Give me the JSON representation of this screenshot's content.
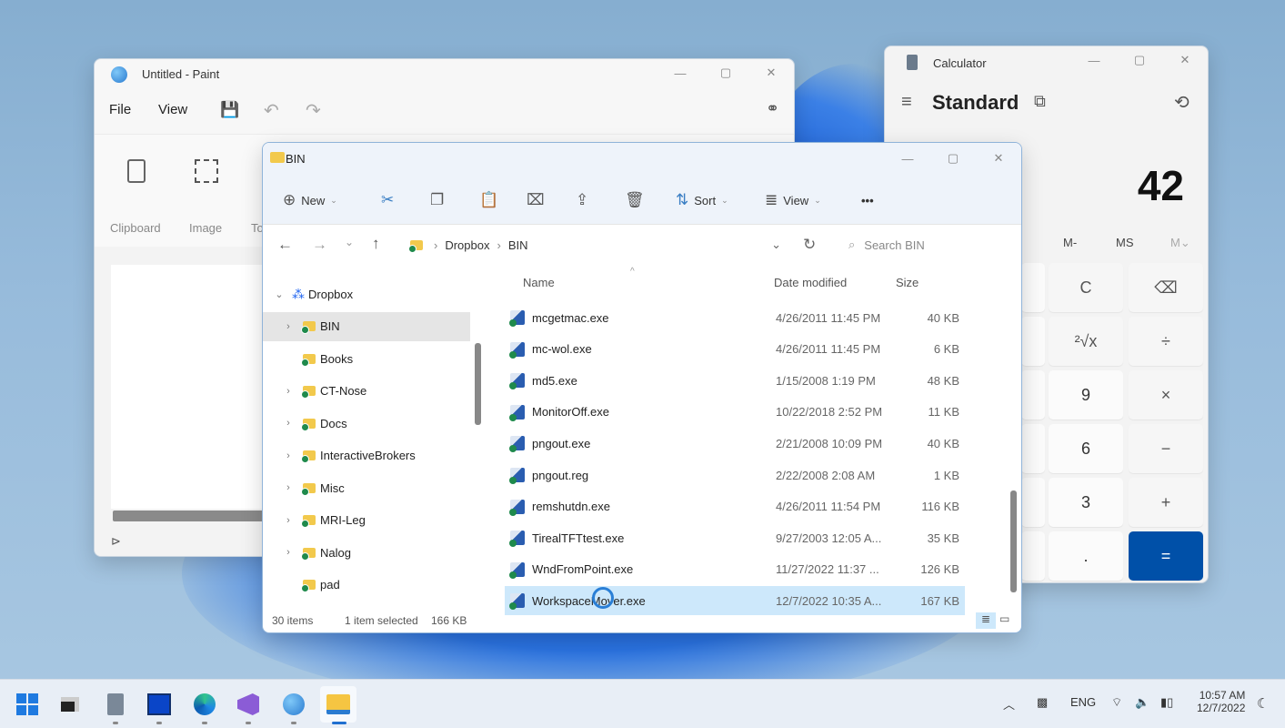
{
  "paint": {
    "title": "Untitled - Paint",
    "menu": [
      "File",
      "View"
    ],
    "groups": [
      "Clipboard",
      "Image",
      "To"
    ]
  },
  "explorer": {
    "title": "BIN",
    "commands": {
      "new": "New",
      "sort": "Sort",
      "view": "View",
      "more": "•••"
    },
    "breadcrumb": [
      "Dropbox",
      "BIN"
    ],
    "search_placeholder": "Search BIN",
    "columns": {
      "name": "Name",
      "date": "Date modified",
      "size": "Size"
    },
    "nav": [
      {
        "label": "Dropbox",
        "expanded": true
      },
      {
        "label": "BIN",
        "selected": true
      },
      {
        "label": "Books"
      },
      {
        "label": "CT-Nose"
      },
      {
        "label": "Docs"
      },
      {
        "label": "InteractiveBrokers"
      },
      {
        "label": "Misc"
      },
      {
        "label": "MRI-Leg"
      },
      {
        "label": "Nalog"
      },
      {
        "label": "pad"
      }
    ],
    "files": [
      {
        "name": "mcgetmac.exe",
        "date": "4/26/2011 11:45 PM",
        "size": "40 KB"
      },
      {
        "name": "mc-wol.exe",
        "date": "4/26/2011 11:45 PM",
        "size": "6 KB"
      },
      {
        "name": "md5.exe",
        "date": "1/15/2008 1:19 PM",
        "size": "48 KB"
      },
      {
        "name": "MonitorOff.exe",
        "date": "10/22/2018 2:52 PM",
        "size": "11 KB"
      },
      {
        "name": "pngout.exe",
        "date": "2/21/2008 10:09 PM",
        "size": "40 KB"
      },
      {
        "name": "pngout.reg",
        "date": "2/22/2008 2:08 AM",
        "size": "1 KB"
      },
      {
        "name": "remshutdn.exe",
        "date": "4/26/2011 11:54 PM",
        "size": "116 KB"
      },
      {
        "name": "TirealTFTtest.exe",
        "date": "9/27/2003 12:05 A...",
        "size": "35 KB"
      },
      {
        "name": "WndFromPoint.exe",
        "date": "11/27/2022 11:37 ...",
        "size": "126 KB"
      },
      {
        "name": "WorkspaceMover.exe",
        "date": "12/7/2022 10:35 A...",
        "size": "167 KB",
        "selected": true
      }
    ],
    "status": {
      "count": "30 items",
      "selected": "1 item selected",
      "size": "166 KB"
    }
  },
  "calculator": {
    "title": "Calculator",
    "mode": "Standard",
    "display": "42",
    "memory": [
      "M-",
      "MS",
      "M⌄"
    ],
    "keys": [
      {
        "label": "C",
        "type": "op"
      },
      {
        "label": "⌫",
        "type": "op"
      },
      {
        "label": "²√x",
        "type": "op"
      },
      {
        "label": "÷",
        "type": "op"
      },
      {
        "label": "9",
        "type": "num"
      },
      {
        "label": "×",
        "type": "op"
      },
      {
        "label": "6",
        "type": "num"
      },
      {
        "label": "−",
        "type": "op"
      },
      {
        "label": "3",
        "type": "num"
      },
      {
        "label": "+",
        "type": "op"
      },
      {
        "label": ".",
        "type": "num"
      },
      {
        "label": "=",
        "type": "eq"
      }
    ]
  },
  "taskbar": {
    "apps": [
      "start",
      "task-view",
      "calculator",
      "screen-app",
      "edge",
      "visual-studio",
      "paint",
      "file-explorer"
    ],
    "language": "ENG",
    "time": "10:57 AM",
    "date": "12/7/2022"
  },
  "colors": {
    "accent": "#0050a8",
    "selection": "#cde8fb"
  }
}
